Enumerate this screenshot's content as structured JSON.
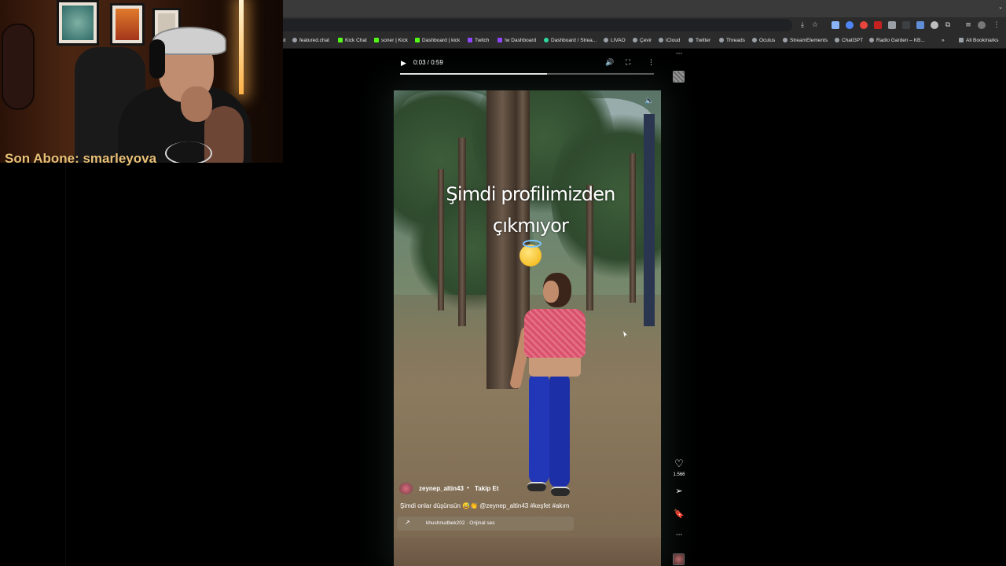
{
  "browser": {
    "bookmarks": [
      {
        "label": "featured.chat",
        "color": "#9aa0a6"
      },
      {
        "label": "Kick Chat",
        "color": "#53fc18"
      },
      {
        "label": "soner | Kick",
        "color": "#53fc18"
      },
      {
        "label": "Dashboard | kick",
        "color": "#53fc18"
      },
      {
        "label": "Twitch",
        "color": "#9146ff"
      },
      {
        "label": "!w Dashboard",
        "color": "#9146ff"
      },
      {
        "label": "Dashboard / Strea...",
        "color": "#2fd6a1"
      },
      {
        "label": "LIVAO",
        "color": "#9aa0a6"
      },
      {
        "label": "Çevir",
        "color": "#9aa0a6"
      },
      {
        "label": "iCloud",
        "color": "#9aa0a6"
      },
      {
        "label": "Twitter",
        "color": "#9aa0a6"
      },
      {
        "label": "Threads",
        "color": "#9aa0a6"
      },
      {
        "label": "Oculus",
        "color": "#9aa0a6"
      },
      {
        "label": "StreamElements",
        "color": "#9aa0a6"
      },
      {
        "label": "ChatGPT",
        "color": "#9aa0a6"
      },
      {
        "label": "Radio Garden – KB...",
        "color": "#9aa0a6"
      }
    ],
    "more_bookmarks": "»",
    "all_bookmarks": "All Bookmarks"
  },
  "overlay": {
    "subtitle": "Son Abone: smarleyova"
  },
  "player": {
    "time": "0:03 / 0:59",
    "progress": 0.58
  },
  "reel": {
    "caption_line1": "Şimdi profilimizden",
    "caption_line2": "çıkmıyor",
    "caption_emoji": "smiling-face-with-halo",
    "username": "zeynep_altin43",
    "separator": "•",
    "follow_label": "Takip Et",
    "description": "Şimdi onlar düşünsün 😅👏 @zeynep_altin43 #keşfet #akım",
    "audio": "khushnudbek202 · Orijinal ses",
    "like_count": "1.566"
  }
}
